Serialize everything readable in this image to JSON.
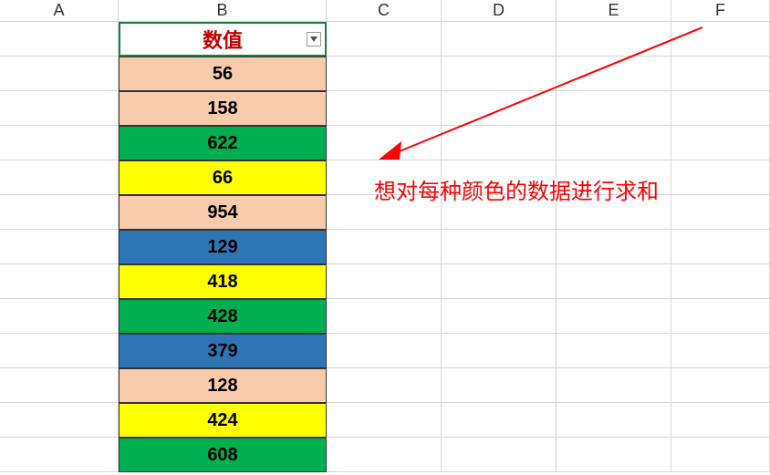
{
  "columns": {
    "A": "A",
    "B": "B",
    "C": "C",
    "D": "D",
    "E": "E",
    "F": "F"
  },
  "header": {
    "label": "数值"
  },
  "rows": [
    {
      "value": "56",
      "fill": "peach"
    },
    {
      "value": "158",
      "fill": "peach"
    },
    {
      "value": "622",
      "fill": "green"
    },
    {
      "value": "66",
      "fill": "yellow"
    },
    {
      "value": "954",
      "fill": "peach"
    },
    {
      "value": "129",
      "fill": "blue"
    },
    {
      "value": "418",
      "fill": "yellow"
    },
    {
      "value": "428",
      "fill": "green"
    },
    {
      "value": "379",
      "fill": "blue"
    },
    {
      "value": "128",
      "fill": "peach"
    },
    {
      "value": "424",
      "fill": "yellow"
    },
    {
      "value": "608",
      "fill": "green"
    }
  ],
  "annotation": {
    "text": "想对每种颜色的数据进行求和"
  },
  "colors": {
    "peach": "#f8cbad",
    "green": "#00b050",
    "yellow": "#ffff00",
    "blue": "#2e75b6"
  }
}
